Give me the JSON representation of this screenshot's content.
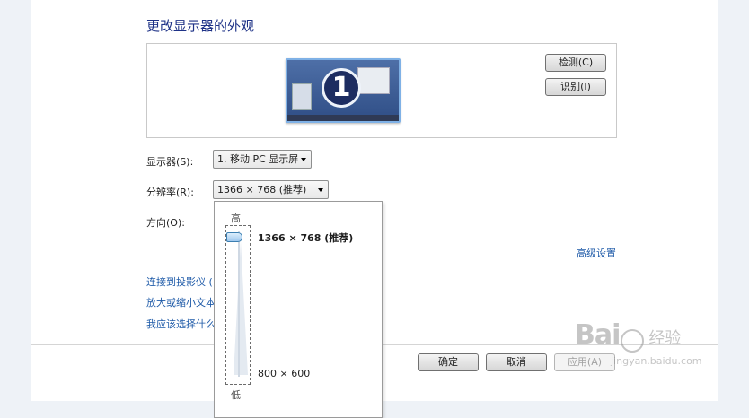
{
  "title": "更改显示器的外观",
  "preview": {
    "monitor_number": "1",
    "detect_label": "检测(C)",
    "identify_label": "识别(I)"
  },
  "display_row": {
    "label": "显示器(S):",
    "value": "1. 移动 PC 显示屏"
  },
  "resolution_row": {
    "label": "分辨率(R):",
    "value": "1366 × 768 (推荐)"
  },
  "orientation_row": {
    "label": "方向(O):"
  },
  "advanced_link": "高级设置",
  "links": [
    "连接到投影仪 (",
    "放大或缩小文本",
    "我应该选择什么"
  ],
  "buttons": {
    "ok": "确定",
    "cancel": "取消",
    "apply": "应用(A)"
  },
  "resolution_dropdown": {
    "high_label": "高",
    "low_label": "低",
    "top_value": "1366 × 768 (推荐)",
    "bottom_value": "800 × 600",
    "slider_position": 1.0
  },
  "watermark": {
    "brand": "Bai",
    "brand_suffix": "经验",
    "url": "jingyan.baidu.com"
  }
}
